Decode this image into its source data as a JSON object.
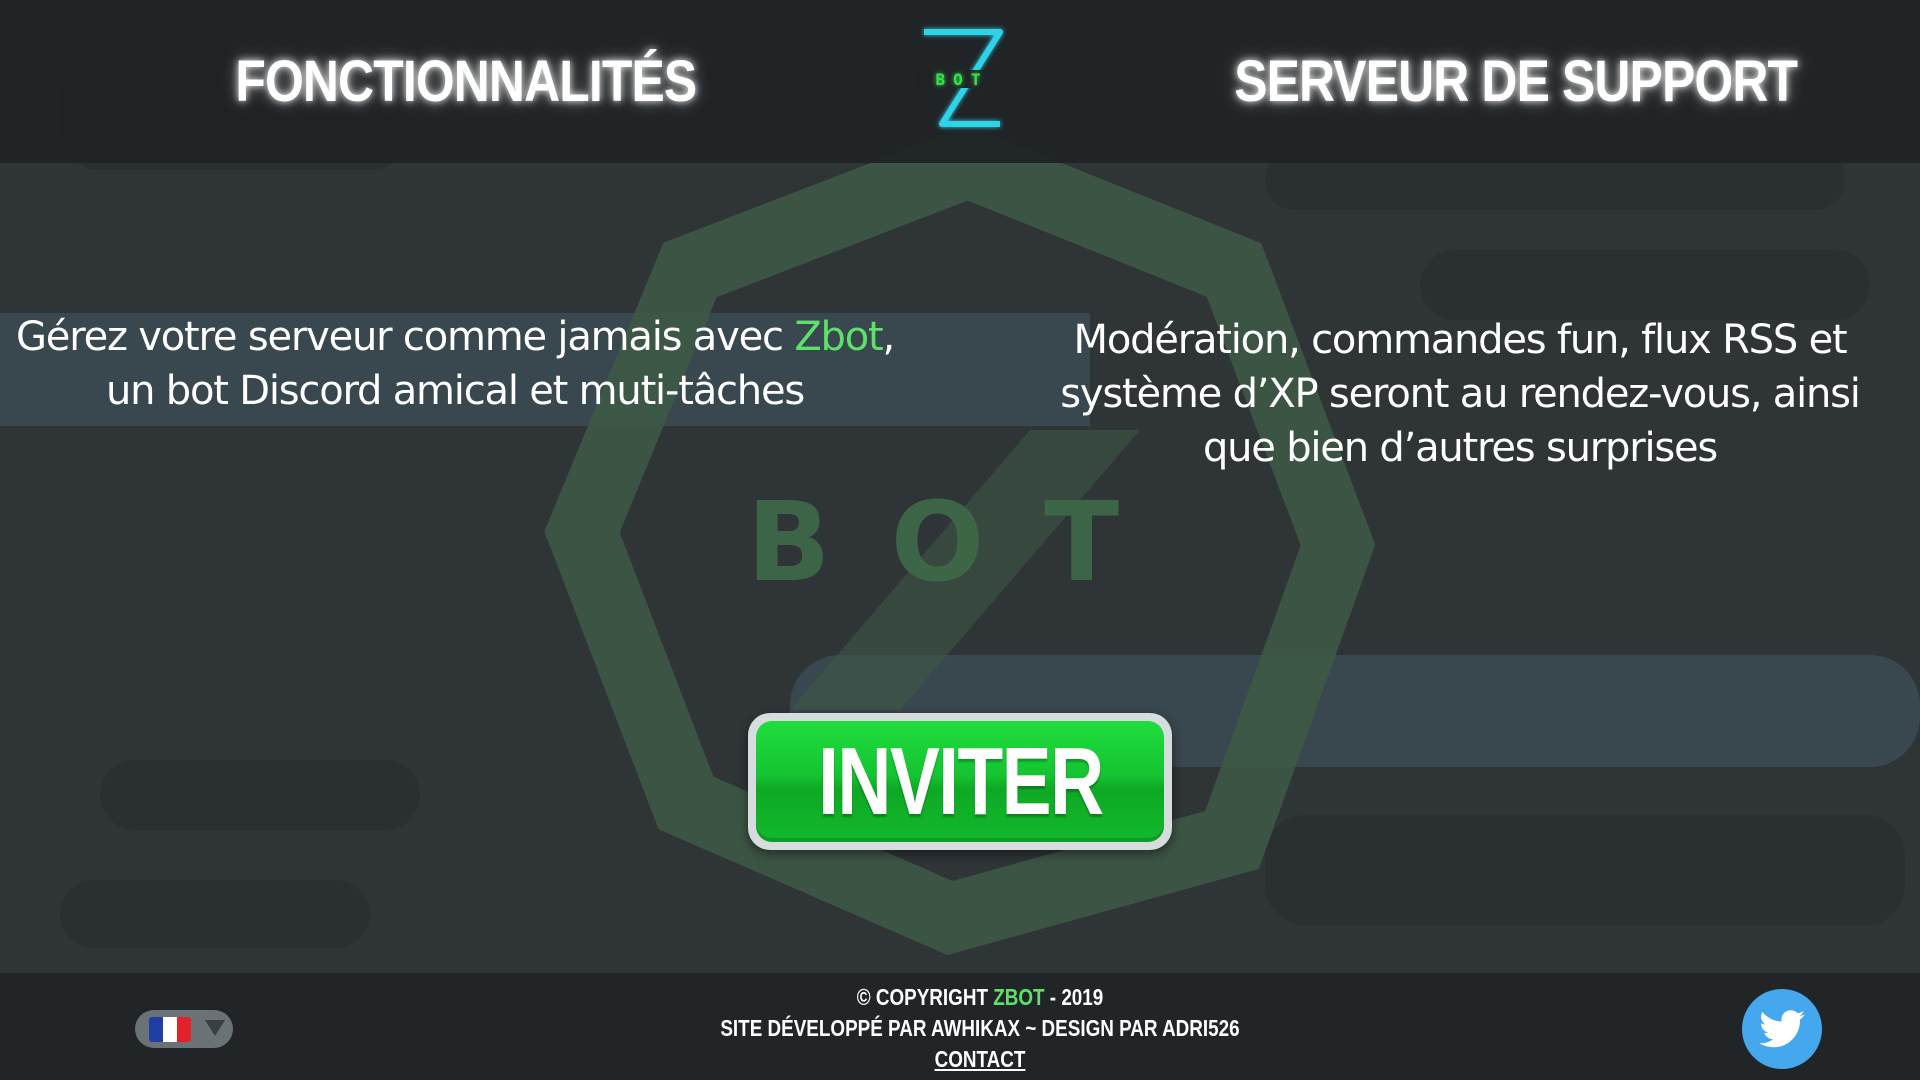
{
  "header": {
    "nav_features": "Fonctionnalités",
    "nav_support": "Serveur de support",
    "logo_letter": "Z",
    "logo_word": "BOT"
  },
  "background": {
    "watermark_word": "BOT"
  },
  "intro": {
    "left_part1": "Gérez votre serveur comme jamais avec ",
    "left_brand": "Zbot",
    "left_part2": ", un bot Discord amical et muti-tâches",
    "right_text": "Modération, commandes fun, flux RSS et système d’XP seront au rendez-vous, ainsi que bien d’autres surprises"
  },
  "cta": {
    "invite_label": "INVITER"
  },
  "footer": {
    "copyright_prefix": "© Copyright ",
    "copyright_brand": "Zbot",
    "copyright_suffix": " - 2019",
    "credits": "Site développé par Awhikax ~ Design par Adri526",
    "contact": "Contact"
  },
  "language": {
    "current": "fr",
    "flag_colors": [
      "#1f3fa6",
      "#ffffff",
      "#e0232b"
    ]
  },
  "social": {
    "icon": "twitter-icon"
  },
  "colors": {
    "accent": "#5ee06a",
    "button_green": "#14c431",
    "twitter_blue": "#45a8ee",
    "header_bg": "#202325",
    "page_bg": "#2f3437"
  }
}
